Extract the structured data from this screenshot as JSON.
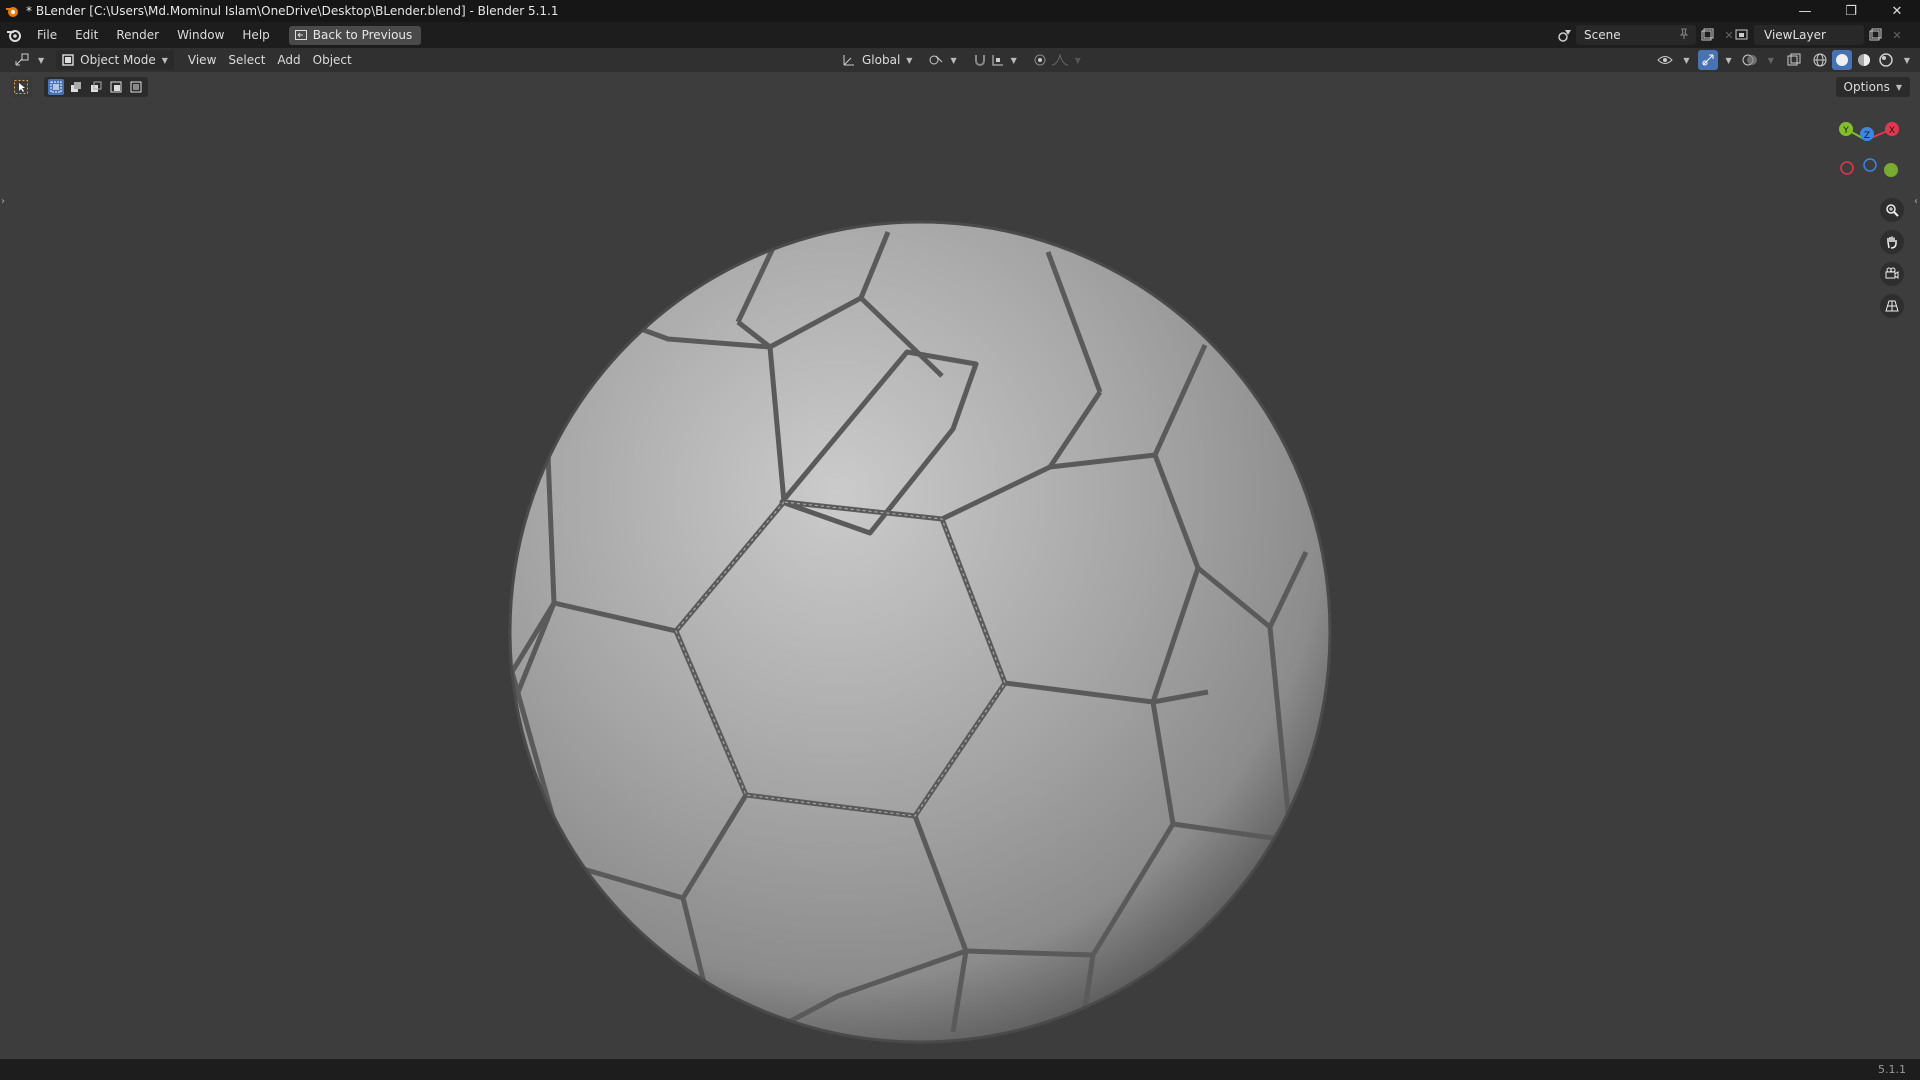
{
  "window": {
    "title": "* BLender [C:\\Users\\Md.Mominul Islam\\OneDrive\\Desktop\\BLender.blend] - Blender 5.1.1",
    "minimize_glyph": "—",
    "maximize_glyph": "❐",
    "close_glyph": "✕"
  },
  "menubar": {
    "items": [
      "File",
      "Edit",
      "Render",
      "Window",
      "Help"
    ],
    "back_button": "Back to Previous",
    "scene": "Scene",
    "view_layer": "ViewLayer"
  },
  "viewport_header": {
    "mode": "Object Mode",
    "menus": [
      "View",
      "Select",
      "Add",
      "Object"
    ],
    "orientation": "Global",
    "options": "Options"
  },
  "gizmo": {
    "axis_y": "Y",
    "axis_z": "Z",
    "axis_x": "X",
    "colors": {
      "x": "#e2374f",
      "y": "#83be2d",
      "z": "#3a86e0"
    }
  },
  "statusbar": {
    "version": "5.1.1"
  },
  "colors": {
    "accent": "#4772b3",
    "background": "#3d3d3d"
  }
}
